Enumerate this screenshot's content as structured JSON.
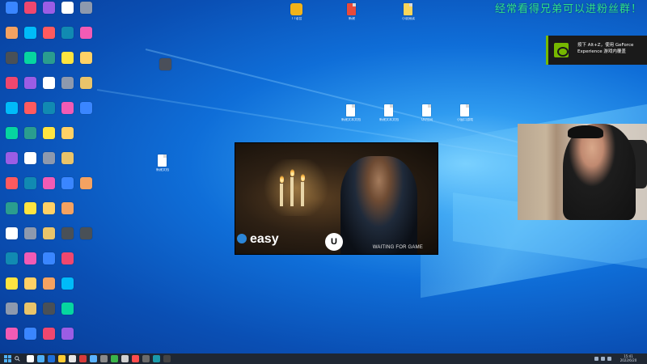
{
  "overlay": {
    "text": "经常看得兄弟可以进粉丝群！"
  },
  "notification": {
    "text": "按下 Alt+Z，使用 GeForce Experience 游戏内覆盖"
  },
  "game": {
    "brand": "easy",
    "engine": "U",
    "status": "WAITING FOR GAME"
  },
  "taskbar": {
    "time": "15:41",
    "date": "2022/6/20"
  },
  "desktop_labels": {
    "top": [
      "TT语音",
      "新建",
      "小说阅读"
    ],
    "files": [
      "新建文本文档",
      "新建文本文档",
      "QQ空间",
      "小窗口游戏",
      "新建文档"
    ]
  },
  "colors": {
    "accent": "#2ee08a",
    "nvidia": "#76b900",
    "taskbar": "#1f2733"
  }
}
